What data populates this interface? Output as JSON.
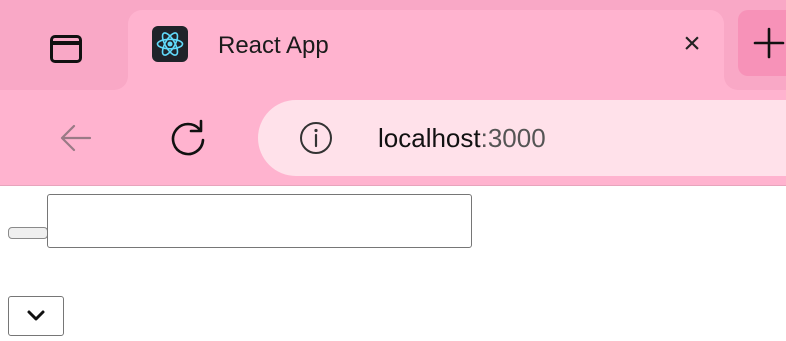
{
  "browser": {
    "tab": {
      "title": "React App",
      "favicon": "react-logo-icon",
      "close_glyph": "×"
    },
    "tab_actions_icon": "tab-actions-icon",
    "new_tab_icon": "plus-icon",
    "toolbar": {
      "back_icon": "arrow-left-icon",
      "reload_icon": "reload-icon",
      "site_info_icon": "info-circle-icon",
      "url_host": "localhost",
      "url_port": ":3000"
    },
    "colors": {
      "tabstrip": "#f9a8c6",
      "active_tab": "#ffb3cf",
      "omnibox": "#ffe1ea"
    }
  },
  "page": {
    "range_input_icon": "range-slider",
    "text_input_value": "",
    "select_value": "",
    "select_icon": "chevron-down-icon"
  }
}
